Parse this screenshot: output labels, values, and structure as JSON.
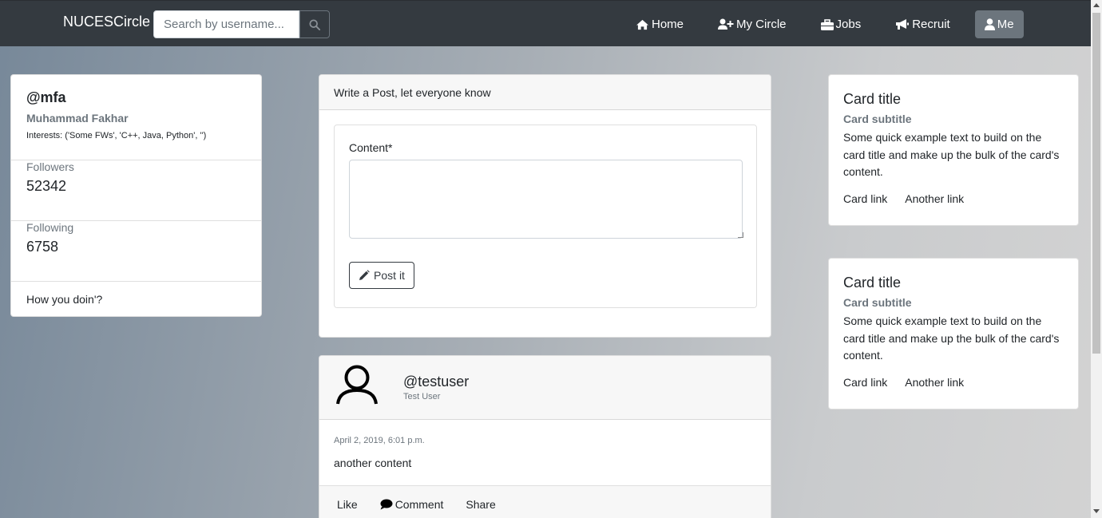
{
  "navbar": {
    "brand": "NUCESCircle",
    "search_placeholder": "Search by username...",
    "items": [
      {
        "label": "Home",
        "icon": "home-icon"
      },
      {
        "label": "My Circle",
        "icon": "user-plus-icon"
      },
      {
        "label": "Jobs",
        "icon": "briefcase-icon"
      },
      {
        "label": "Recruit",
        "icon": "bullhorn-icon"
      },
      {
        "label": "Me",
        "icon": "user-icon",
        "active": true
      }
    ]
  },
  "profile": {
    "handle": "@mfa",
    "name": "Muhammad Fakhar",
    "interests": "Interests: ('Some FWs', 'C++, Java, Python', '')",
    "followers_label": "Followers",
    "followers": "52342",
    "following_label": "Following",
    "following": "6758",
    "status": "How you doin'?"
  },
  "post_form": {
    "header": "Write a Post, let everyone know",
    "content_label": "Content*",
    "content_value": "",
    "button": "Post it"
  },
  "feed": [
    {
      "handle": "@testuser",
      "name": "Test User",
      "date": "April 2, 2019, 6:01 p.m.",
      "content": "another content",
      "actions": [
        "Like",
        "Comment",
        "Share"
      ]
    }
  ],
  "side_cards": [
    {
      "title": "Card title",
      "subtitle": "Card subtitle",
      "text": "Some quick example text to build on the card title and make up the bulk of the card's content.",
      "link1": "Card link",
      "link2": "Another link"
    },
    {
      "title": "Card title",
      "subtitle": "Card subtitle",
      "text": "Some quick example text to build on the card title and make up the bulk of the card's content.",
      "link1": "Card link",
      "link2": "Another link"
    }
  ],
  "colors": {
    "navbar": "#343a40",
    "active_nav": "#6c757d",
    "muted": "#6c757d"
  }
}
